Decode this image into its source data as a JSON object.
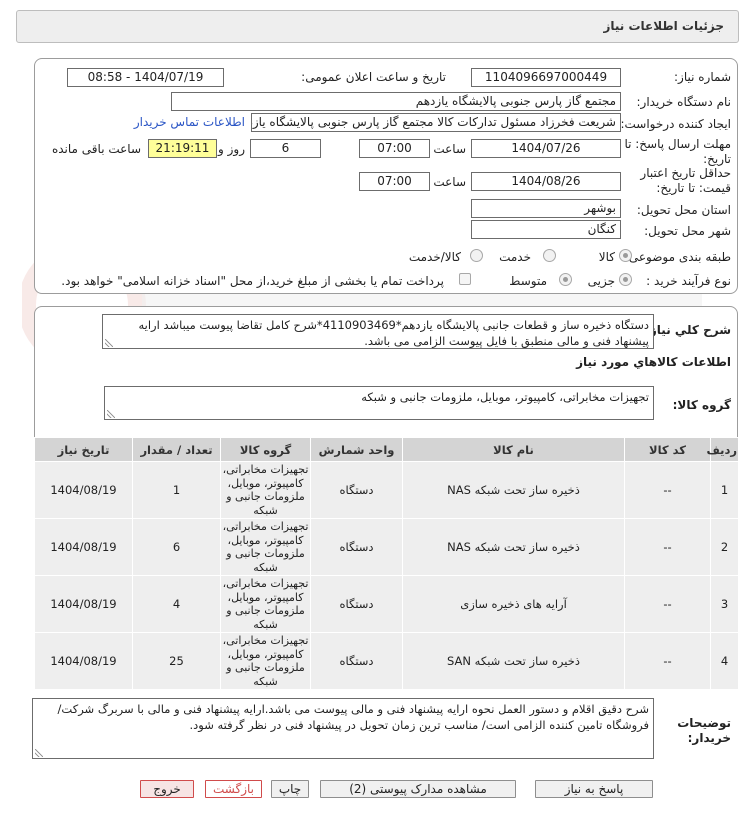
{
  "page": {
    "title": "جزئیات اطلاعات نیاز"
  },
  "header": {
    "need_number_label": "شماره نیاز:",
    "need_number": "1104096697000449",
    "announce_label": "تاریخ و ساعت اعلان عمومی:",
    "announce_value": "1404/07/19 - 08:58",
    "buyer_label": "نام دستگاه خریدار:",
    "buyer_value": "مجتمع گاز پارس جنوبی  پالایشگاه یازدهم",
    "creator_label": "ایجاد کننده درخواست:",
    "creator_value": "شریعت فخرزاد مسئول تدارکات کالا مجتمع گاز پارس جنوبی  پالایشگاه یازدهم",
    "contact_link": "اطلاعات تماس خریدار",
    "deadline_label": "مهلت ارسال پاسخ: تا تاریخ:",
    "deadline_date": "1404/07/26",
    "time_label": "ساعت",
    "deadline_time": "07:00",
    "days_value": "6",
    "days_label": "روز و",
    "remaining_time": "21:19:11",
    "remaining_label": "ساعت باقی مانده",
    "validity_label": "حداقل تاریخ اعتبار قیمت: تا تاریخ:",
    "validity_date": "1404/08/26",
    "validity_time": "07:00",
    "province_label": "استان محل تحویل:",
    "province_value": "بوشهر",
    "city_label": "شهر محل تحویل:",
    "city_value": "کنگان",
    "category_label": "طبقه بندی موضوعی:",
    "category_options": [
      "کالا",
      "خدمت",
      "کالا/خدمت"
    ],
    "category_selected": "کالا",
    "process_label": "نوع فرآیند خرید :",
    "process_options": [
      "جزیی",
      "متوسط"
    ],
    "payment_text": "پرداخت تمام یا بخشی از مبلغ خرید،از محل \"اسناد خزانه اسلامی\" خواهد بود."
  },
  "summary": {
    "label": "شرح کلي نياز:",
    "text": "دستگاه ذخیره ساز و قطعات جانبی پالایشگاه یازدهم*4110903469*شرح کامل تقاضا پیوست میباشد ارایه پیشنهاد فنی و مالی منطبق با فایل پیوست الزامی می باشد."
  },
  "goods_info": {
    "section_title": "اطلاعات کالاهاي مورد نياز",
    "group_label": "گروه کالا:",
    "group_value": "تجهیزات مخابراتی، کامپیوتر، موبایل، ملزومات جانبی و شبکه"
  },
  "table": {
    "headers": [
      "ردیف",
      "کد کالا",
      "نام کالا",
      "واحد شمارش",
      "گروه کالا",
      "تعداد / مقدار",
      "تاریخ نیاز"
    ],
    "rows": [
      {
        "idx": "1",
        "code": "--",
        "name": "ذخیره ساز تحت شبکه NAS",
        "unit": "دستگاه",
        "group": "تجهیزات مخابراتی، کامپیوتر، موبایل، ملزومات جانبی و شبکه",
        "qty": "1",
        "date": "1404/08/19"
      },
      {
        "idx": "2",
        "code": "--",
        "name": "ذخیره ساز تحت شبکه NAS",
        "unit": "دستگاه",
        "group": "تجهیزات مخابراتی، کامپیوتر، موبایل، ملزومات جانبی و شبکه",
        "qty": "6",
        "date": "1404/08/19"
      },
      {
        "idx": "3",
        "code": "--",
        "name": "آرایه های ذخیره سازی",
        "unit": "دستگاه",
        "group": "تجهیزات مخابراتی، کامپیوتر، موبایل، ملزومات جانبی و شبکه",
        "qty": "4",
        "date": "1404/08/19"
      },
      {
        "idx": "4",
        "code": "--",
        "name": "ذخیره ساز تحت شبکه SAN",
        "unit": "دستگاه",
        "group": "تجهیزات مخابراتی، کامپیوتر، موبایل، ملزومات جانبی و شبکه",
        "qty": "25",
        "date": "1404/08/19"
      }
    ]
  },
  "buyer_notes": {
    "label": "توضیحات خریدار:",
    "text": "شرح دقیق اقلام و دستور العمل نحوه ارایه پیشنهاد فنی و مالی پیوست می باشد.ارایه پیشنهاد فنی و مالی با سربرگ شرکت/فروشگاه تامین کننده الزامی است/ مناسب ترین زمان تحویل در پیشنهاد فنی در نظر گرفته شود."
  },
  "buttons": {
    "respond": "پاسخ به نیاز",
    "attachments": "مشاهده مدارک پیوستی (2)",
    "print": "چاپ",
    "back": "بازگشت",
    "exit": "خروج"
  },
  "colors": {
    "link": "#2a55c5",
    "highlight": "#ffff99",
    "header_bg": "#d4d4d4",
    "exit_border": "#d04b4b"
  }
}
